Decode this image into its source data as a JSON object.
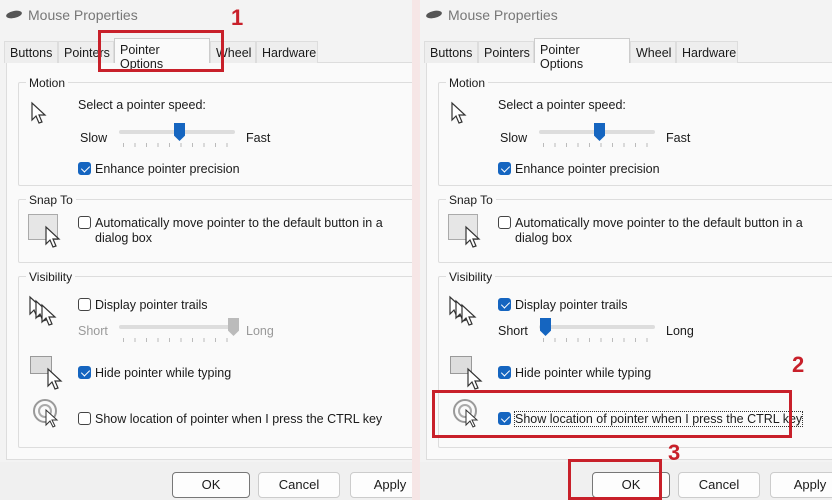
{
  "annotation_color": "#c8202a",
  "accent": "#1565c0",
  "window_title": "Mouse Properties",
  "tabs": [
    "Buttons",
    "Pointers",
    "Pointer Options",
    "Wheel",
    "Hardware"
  ],
  "motion": {
    "group": "Motion",
    "label": "Select a pointer speed:",
    "slow": "Slow",
    "fast": "Fast",
    "precision": "Enhance pointer precision"
  },
  "snap": {
    "group": "Snap To",
    "label_line1": "Automatically move pointer to the default button in a",
    "label_line2": "dialog box"
  },
  "visibility": {
    "group": "Visibility",
    "trails": "Display pointer trails",
    "short": "Short",
    "long": "Long",
    "hide": "Hide pointer while typing",
    "ctrl": "Show location of pointer when I press the CTRL key"
  },
  "buttons": {
    "ok": "OK",
    "cancel": "Cancel",
    "apply": "Apply"
  },
  "panels": [
    {
      "speed_percent": 50,
      "precision": true,
      "snap": false,
      "trails": false,
      "trail_percent": 100,
      "hide": true,
      "ctrl": false
    },
    {
      "speed_percent": 50,
      "precision": true,
      "snap": false,
      "trails": true,
      "trail_percent": 0,
      "hide": true,
      "ctrl": true
    }
  ],
  "annotations": [
    "1",
    "2",
    "3"
  ]
}
